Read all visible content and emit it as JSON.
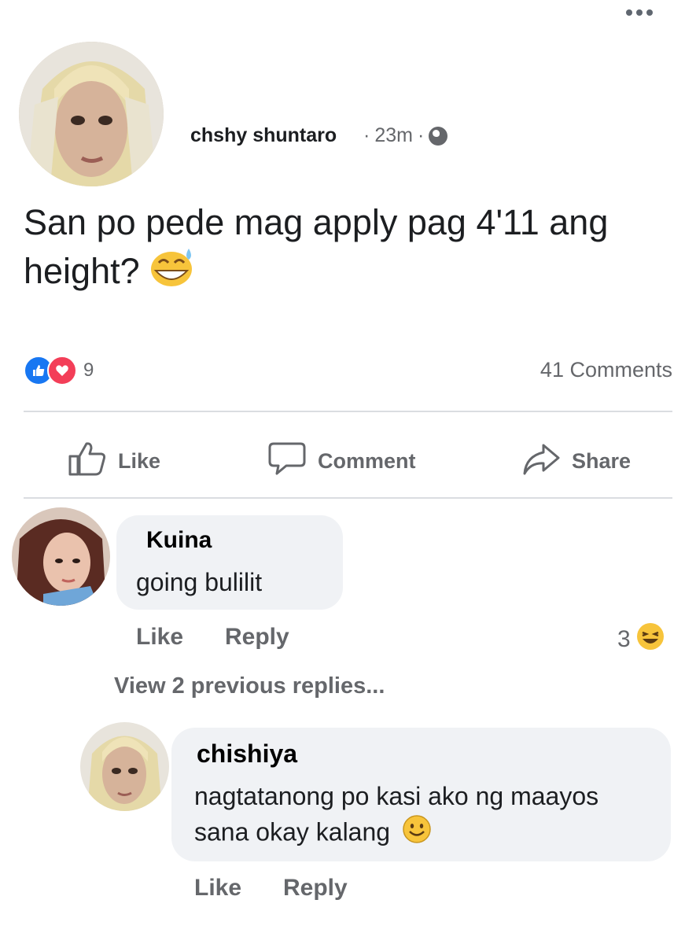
{
  "post": {
    "author": "chshy shuntaro",
    "time": "23m",
    "separator": "·",
    "text": "San po pede mag apply pag 4'11 ang height?",
    "emoji_icon": "grinning-sweat-emoji-icon",
    "reaction_count": "9",
    "comments_count": "41 Comments"
  },
  "actions": {
    "like": "Like",
    "comment": "Comment",
    "share": "Share"
  },
  "comments": [
    {
      "name": "Kuina",
      "text": "going bulilit",
      "like": "Like",
      "reply": "Reply",
      "reaction_count": "3",
      "reaction_icon": "laughing-emoji-icon"
    }
  ],
  "view_previous": "View 2 previous replies...",
  "reply": {
    "name": "chishiya",
    "text": "nagtatanong po kasi ako ng maayos sana okay kalang",
    "emoji_icon": "smiley-emoji-icon",
    "like": "Like",
    "reply": "Reply"
  },
  "colors": {
    "like_blue": "#1877f2",
    "love_red": "#f33e58",
    "muted_text": "#65676b",
    "bubble_bg": "#f0f2f5"
  }
}
